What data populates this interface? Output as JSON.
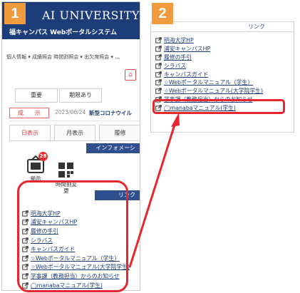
{
  "steps": [
    "1",
    "2"
  ],
  "header": {
    "university": "AI  UNIVERSITY",
    "system_name": "福キャンパス  Webポータルシステム"
  },
  "menu": "個人情報 ▾  成績照会 時間割照会 ▾  出欠席照会 ▾  ⺣",
  "home_icon": "home-icon",
  "filter_tabs": [
    "重要",
    "期限あり"
  ],
  "notice": {
    "badge": "成　　示",
    "date": "2023/06/24",
    "title": "新型コロナウイル"
  },
  "view_tabs": [
    "日表示",
    "月表示",
    "履修"
  ],
  "info_header": "インフォメーシ",
  "info_icons": [
    {
      "label": "掲示",
      "badge": "28",
      "icon": "bulletin-icon"
    },
    {
      "label": "時間割変\n更",
      "icon": "timetable-icon"
    }
  ],
  "links_header": "リンク",
  "links": [
    "明海大学HP",
    "浦安キャンパスHP",
    "履修の手引",
    "シラバス",
    "キャンパスガイド",
    "☆Webポータルマニュアル（学生）",
    "☆Webポータルマニュアル(大学院学生)",
    "学事課（教務担当）からのお知らせ",
    "◯manabaマニュアル(学生)"
  ],
  "panel2_links": [
    "明海大学HP",
    "浦安キャンパスHP",
    "履修の手引",
    "シラバス",
    "キャンパスガイド",
    "☆Webポータルマニュアル（学生）",
    "☆Webポータルマニュアル(大学院学生)",
    "学事課（教務担当）からのお知らせ",
    "◯manabaマニュアル(学生)"
  ],
  "colors": {
    "header_bg": "#1d3c7a",
    "badge_orange": "#ef9b3e",
    "highlight_red": "#e8262d",
    "link_blue": "#1d3c7a"
  }
}
